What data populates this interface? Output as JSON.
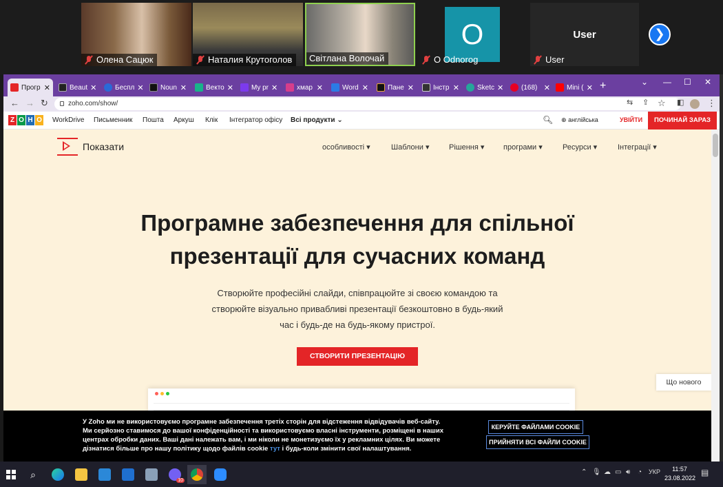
{
  "video": {
    "participants": [
      {
        "name": "Олена Сацюк"
      },
      {
        "name": "Наталия Крутоголов"
      },
      {
        "name": "Світлана Волочай"
      },
      {
        "name": "O Odnorog",
        "avatar_letter": "O"
      },
      {
        "name": "User",
        "label": "User"
      }
    ]
  },
  "browser": {
    "tabs": [
      {
        "label": "Прогр",
        "color": "#e42527"
      },
      {
        "label": "Beaut",
        "color": "#222"
      },
      {
        "label": "Беспл",
        "color": "#2a6ad8"
      },
      {
        "label": "Noun",
        "color": "#111"
      },
      {
        "label": "Векто",
        "color": "#19b38a"
      },
      {
        "label": "My pr",
        "color": "#7c3aed"
      },
      {
        "label": "хмар",
        "color": "#d63e8b"
      },
      {
        "label": "Word",
        "color": "#2c7be5"
      },
      {
        "label": "Пане",
        "color": "#111"
      },
      {
        "label": "Інстр",
        "color": "#333"
      },
      {
        "label": "Sketc",
        "color": "#26a69a"
      },
      {
        "label": "(168)",
        "color": "#e60023"
      },
      {
        "label": "Mini (",
        "color": "#ff0000"
      }
    ],
    "url": "zoho.com/show/"
  },
  "zoho": {
    "logo_letters": [
      "Z",
      "O",
      "H",
      "O"
    ],
    "logo_colors": [
      "#e42527",
      "#089949",
      "#226db4",
      "#f9b21d"
    ],
    "links": [
      "WorkDrive",
      "Письменник",
      "Пошта",
      "Аркуш",
      "Клік",
      "Інтегратор офісу",
      "Всі продукти"
    ],
    "language": "англійська",
    "login": "УВІЙТИ",
    "start": "ПОЧИНАЙ ЗАРАЗ"
  },
  "page": {
    "product_name": "Показати",
    "menu": [
      "особливості",
      "Шаблони",
      "Рішення",
      "програми",
      "Ресурси",
      "Інтеграції"
    ],
    "title_line1": "Програмне забезпечення для спільної",
    "title_line2": "презентації для сучасних команд",
    "subtitle_line1": "Створюйте професійні слайди, співпрацюйте зі своєю командою та",
    "subtitle_line2": "створюйте візуально привабливі презентації безкоштовно в будь-який",
    "subtitle_line3": "час і будь-де на будь-якому пристрої.",
    "cta": "СТВОРИТИ ПРЕЗЕНТАЦІЮ",
    "whats_new": "Що нового"
  },
  "cookie": {
    "line1": "У Zoho ми не використовуємо програмне забезпечення третіх сторін для відстеження відвідувачів веб-сайту.",
    "line2": "Ми серйозно ставимося до вашої конфіденційності та використовуємо власні інструменти, розміщені в наших",
    "line3": "центрах обробки даних. Ваші дані належать вам, і ми ніколи не монетизуємо їх у рекламних цілях. Ви можете",
    "line4_a": "дізнатися більше про нашу політику щодо файлів cookie ",
    "link": "тут",
    "line4_b": " і будь-коли змінити свої налаштування.",
    "manage": "КЕРУЙТЕ ФАЙЛАМИ COOKIE",
    "accept": "ПРИЙНЯТИ ВСІ ФАЙЛИ COOKIE"
  },
  "taskbar": {
    "lang": "УКР",
    "time": "11:57",
    "date": "23.08.2022",
    "badge": "10"
  }
}
